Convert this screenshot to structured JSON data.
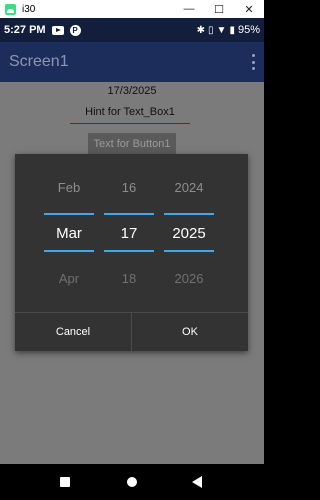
{
  "window": {
    "title": "i30",
    "minimize": "—",
    "maximize": "☐",
    "close": "✕"
  },
  "status_bar": {
    "time": "5:27 PM",
    "battery": "95%",
    "icons": [
      "youtube-icon",
      "p-app-icon",
      "bluetooth-icon",
      "vibrate-icon",
      "wifi-icon",
      "battery-icon"
    ]
  },
  "app_bar": {
    "title": "Screen1"
  },
  "content": {
    "date_label": "17/3/2025",
    "textbox_hint": "Hint for Text_Box1",
    "button_label": "Text for Button1"
  },
  "date_picker": {
    "month": {
      "prev": "Feb",
      "current": "Mar",
      "next": "Apr"
    },
    "day": {
      "prev": "16",
      "current": "17",
      "next": "18"
    },
    "year": {
      "prev": "2024",
      "current": "2025",
      "next": "2026"
    },
    "cancel_label": "Cancel",
    "ok_label": "OK",
    "accent_color": "#3fa9e6"
  }
}
